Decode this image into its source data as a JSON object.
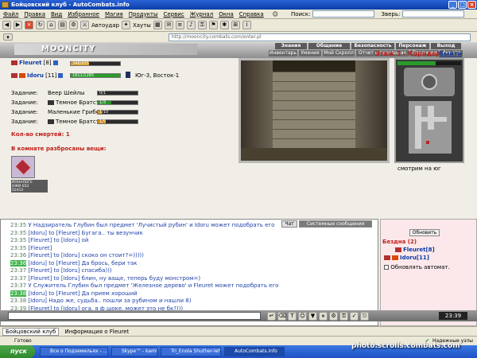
{
  "window": {
    "title": "Бойцовский клуб - AutoCombats.info"
  },
  "menu": [
    "Файл",
    "Правка",
    "Вид",
    "Избранное",
    "Магия",
    "Продукты",
    "Сервис",
    "Журнал",
    "Окна",
    "Справка"
  ],
  "toolbar": {
    "search_label": "Поиск:",
    "beast_label": "Зверь:",
    "autoudar": "Автоудар",
    "hauty": "Хауты"
  },
  "address": {
    "url": "http://mooncity.combats.com/enter.pl"
  },
  "header": {
    "logo": "MOONCITY",
    "nav1": [
      "Знания",
      "Общение",
      "Безопасность",
      "Персонаж",
      "Выход"
    ],
    "nav2": [
      "Инвентарь",
      "Умения",
      "Мой Скролл",
      "Отчет о переводах",
      "Поединки",
      "Анкета"
    ]
  },
  "players": [
    {
      "name": "Fleuret",
      "level": "[8]",
      "hp": "346/935",
      "hp_pct": 0.37
    },
    {
      "name": "Idoru",
      "level": "[11]",
      "hp": "1811/1285",
      "hp_pct": 1.0
    }
  ],
  "location": {
    "coords": "Юг-3, Восток-1",
    "floor": "Этаж 3 - Коридор",
    "exit": "Выйти",
    "direction": "смотрим на юг"
  },
  "tasks": [
    {
      "label": "Задание:",
      "name": "Веер Шейлы",
      "progress": "0/1",
      "fill": 0.05,
      "color": "#2b2b2b"
    },
    {
      "label": "Задание:",
      "name": "Темное Братство",
      "progress": "1/3",
      "fill": 0.33,
      "color": "#2a8f2a"
    },
    {
      "label": "Задание:",
      "name": "Маленькие Грибочки",
      "progress": "1/10",
      "fill": 0.1,
      "color": "#d98a10"
    },
    {
      "label": "Задание:",
      "name": "Темное Братство",
      "progress": "1/5",
      "fill": 0.2,
      "color": "#d98a10"
    }
  ],
  "deaths": {
    "label": "Кол-во смертей: 1"
  },
  "items": {
    "label": "В комнате разбросаны вещи:",
    "caption": [
      "ИОНАЛОГЕ",
      "АЖИ 652",
      "52412"
    ]
  },
  "chat": {
    "tabs": [
      "Чат",
      "Системные сообщения"
    ],
    "lines": [
      {
        "time": "23:35",
        "text": "У Надзиратель Глубин был предмет 'Лучистый рубин' и Idoru может подобрать его",
        "hl": false
      },
      {
        "time": "23:35",
        "text": "[Idoru] to [Fleuret] Бугага.. ты везунчик",
        "hl": false
      },
      {
        "time": "23:35",
        "text": "[Fleuret] to [Idoru] ой",
        "hl": false
      },
      {
        "time": "23:35",
        "text": "[Fleuret]",
        "hl": false
      },
      {
        "time": "23:36",
        "text": "[Fleuret] to [Idoru] скоко он стоит?=)))))",
        "hl": false
      },
      {
        "time": "23:36",
        "text": "[Idoru] to [Fleuret] Да брось, бери так",
        "hl": true
      },
      {
        "time": "23:37",
        "text": "[Fleuret] to [Idoru] спасиба)))",
        "hl": false
      },
      {
        "time": "23:37",
        "text": "[Fleuret] to [Idoru] блин, ну ваще, теперь буду монстром=)",
        "hl": false
      },
      {
        "time": "23:37",
        "text": "У Служитель Глубин был предмет 'Железное дерево' и Fleuret может подобрать его",
        "hl": false
      },
      {
        "time": "23:38",
        "text": "[Idoru] to [Fleuret] Да прием хороший",
        "hl": true
      },
      {
        "time": "23:38",
        "text": "[Idoru] Надо же, судьба.. пошли за рубином и нашли 8)",
        "hl": false
      },
      {
        "time": "23:39",
        "text": "[Fleuret] to [Idoru] ога, я ф шоке, может это не бк?)))",
        "hl": false
      }
    ]
  },
  "panel": {
    "refresh": "Обновить",
    "room": "Бездна (2)",
    "auto": "Обновлять автомат.",
    "members": [
      "Fleuret[8]",
      "Idoru[11]"
    ]
  },
  "clock": "23:39",
  "pagetabs": [
    "Бойцовский клуб",
    "Информация о Fleuret"
  ],
  "status": {
    "left": "Готово",
    "right": "Надежные узлы"
  },
  "taskbar": {
    "start": "пуск",
    "tasks": [
      "Все о Подземельях - ...",
      "Skype™ - kambinzon",
      "Tri_Enola Shuther-leh...",
      "AutoCombats.info"
    ]
  },
  "watermark": "photo.scrolls.combats.com"
}
